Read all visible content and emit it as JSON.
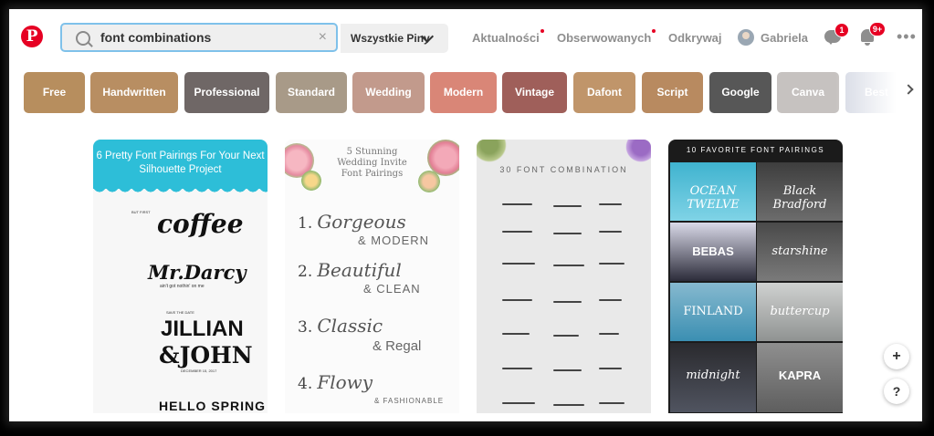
{
  "header": {
    "logo_letter": "P",
    "search": {
      "value": "font combinations",
      "clear": "×"
    },
    "scope_label": "Wszystkie Piny",
    "nav": [
      {
        "label": "Aktualności",
        "has_dot": true
      },
      {
        "label": "Obserwowanych",
        "has_dot": true
      },
      {
        "label": "Odkrywaj",
        "has_dot": false
      }
    ],
    "user_name": "Gabriela",
    "messages_badge": "1",
    "notifications_badge": "9+",
    "more": "•••"
  },
  "chips": [
    {
      "label": "Free",
      "color": "#b78e5e"
    },
    {
      "label": "Handwritten",
      "color": "#b88e62"
    },
    {
      "label": "Professional",
      "color": "#6f6766"
    },
    {
      "label": "Standard",
      "color": "#a89a88"
    },
    {
      "label": "Wedding",
      "color": "#c29a8c"
    },
    {
      "label": "Modern",
      "color": "#d98677"
    },
    {
      "label": "Vintage",
      "color": "#9f5f5a"
    },
    {
      "label": "Dafont",
      "color": "#c0956a"
    },
    {
      "label": "Script",
      "color": "#b88a60"
    },
    {
      "label": "Google",
      "color": "#575757"
    },
    {
      "label": "Canva",
      "color": "#c6c2c0"
    },
    {
      "label": "Best",
      "color": "#d4d8e3"
    }
  ],
  "pins": {
    "p1": {
      "title": "6 Pretty Font Pairings For Your Next Silhouette Project",
      "words": [
        "coffee",
        "Mr.Darcy",
        "JILLIAN",
        "&JOHN",
        "HELLO SPRING"
      ],
      "captions": [
        "BUT FIRST",
        "ain't got nothin' on me",
        "SAVE THE DATE",
        "DECEMBER 15, 2017"
      ]
    },
    "p2": {
      "title": "5 Stunning Wedding Invite Font Pairings",
      "items": [
        {
          "num": "1.",
          "script": "Gorgeous",
          "sub": "& MODERN"
        },
        {
          "num": "2.",
          "script": "Beautiful",
          "sub": "& CLEAN"
        },
        {
          "num": "3.",
          "script": "Classic",
          "sub": "& Regal"
        },
        {
          "num": "4.",
          "script": "Flowy",
          "sub": "& FASHIONABLE"
        }
      ]
    },
    "p3": {
      "title": "30 FONT COMBINATION"
    },
    "p4": {
      "title": "10 FAVORITE FONT PAIRINGS",
      "tiles": [
        "OCEAN TWELVE",
        "Black Bradford",
        "BEBAS",
        "starshine",
        "FINLAND",
        "buttercup",
        "midnight",
        "KAPRA"
      ]
    }
  },
  "float_buttons": {
    "add": "+",
    "help": "?"
  }
}
